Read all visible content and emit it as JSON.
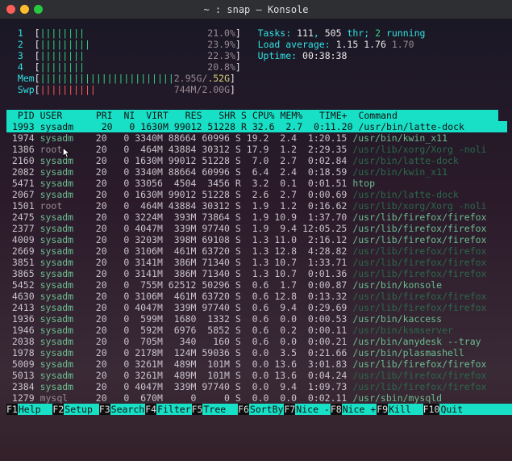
{
  "titlebar": {
    "title": "~ : snap — Konsole"
  },
  "cpu_meters": [
    {
      "id": "1",
      "pct": "21.0%"
    },
    {
      "id": "2",
      "pct": "23.9%"
    },
    {
      "id": "3",
      "pct": "22.3%"
    },
    {
      "id": "4",
      "pct": "20.8%"
    }
  ],
  "mem": {
    "label": "Mem",
    "used": "2.95G",
    "slab": ".52G",
    "pct": ""
  },
  "swp": {
    "label": "Swp",
    "used": "744M",
    "total": "2.00G"
  },
  "summary": {
    "tasks_label": "Tasks:",
    "tasks": "111",
    "thr": "505",
    "thr_label": "thr;",
    "running": "2",
    "running_label": "running",
    "la_label": "Load average:",
    "la1": "1.15",
    "la2": "1.76",
    "la3": "1.70",
    "up_label": "Uptime:",
    "uptime": "00:38:38"
  },
  "columns": {
    "pid": "PID",
    "user": "USER",
    "pri": "PRI",
    "ni": "NI",
    "virt": "VIRT",
    "res": "RES",
    "shr": "SHR",
    "s": "S",
    "cpu": "CPU%",
    "mem": "MEM%",
    "time": "TIME+",
    "cmd": "Command"
  },
  "selected": {
    "pid": "1993",
    "user": "sysadm",
    "pri": "20",
    "ni": "0",
    "virt": "1630M",
    "res": "99012",
    "shr": "51228",
    "s": "R",
    "cpu": "32.6",
    "mem": "2.7",
    "time": "0:11.20",
    "cmd": "/usr/bin/latte-dock"
  },
  "procs": [
    {
      "pid": "1974",
      "user": "sysadm",
      "pri": "20",
      "ni": "0",
      "virt": "3340M",
      "res": "88664",
      "shr": "60996",
      "s": "S",
      "cpu": "19.2",
      "mem": "2.4",
      "time": "1:20.15",
      "cmd": "/usr/bin/kwin_x11",
      "dim": false
    },
    {
      "pid": "1386",
      "user": "root",
      "pri": "20",
      "ni": "0",
      "virt": "464M",
      "res": "43884",
      "shr": "30312",
      "s": "S",
      "cpu": "17.9",
      "mem": "1.2",
      "time": "2:29.35",
      "cmd": "/usr/lib/xorg/Xorg -noli",
      "dim": true
    },
    {
      "pid": "2160",
      "user": "sysadm",
      "pri": "20",
      "ni": "0",
      "virt": "1630M",
      "res": "99012",
      "shr": "51228",
      "s": "S",
      "cpu": "7.0",
      "mem": "2.7",
      "time": "0:02.84",
      "cmd": "/usr/bin/latte-dock",
      "dim": true
    },
    {
      "pid": "2082",
      "user": "sysadm",
      "pri": "20",
      "ni": "0",
      "virt": "3340M",
      "res": "88664",
      "shr": "60996",
      "s": "S",
      "cpu": "6.4",
      "mem": "2.4",
      "time": "0:18.59",
      "cmd": "/usr/bin/kwin_x11",
      "dim": true
    },
    {
      "pid": "5471",
      "user": "sysadm",
      "pri": "20",
      "ni": "0",
      "virt": "33056",
      "res": "4504",
      "shr": "3456",
      "s": "R",
      "cpu": "3.2",
      "mem": "0.1",
      "time": "0:01.51",
      "cmd": "htop",
      "dim": false
    },
    {
      "pid": "2067",
      "user": "sysadm",
      "pri": "20",
      "ni": "0",
      "virt": "1630M",
      "res": "99012",
      "shr": "51228",
      "s": "S",
      "cpu": "2.6",
      "mem": "2.7",
      "time": "0:00.69",
      "cmd": "/usr/bin/latte-dock",
      "dim": true
    },
    {
      "pid": "1501",
      "user": "root",
      "pri": "20",
      "ni": "0",
      "virt": "464M",
      "res": "43884",
      "shr": "30312",
      "s": "S",
      "cpu": "1.9",
      "mem": "1.2",
      "time": "0:16.62",
      "cmd": "/usr/lib/xorg/Xorg -noli",
      "dim": true
    },
    {
      "pid": "2475",
      "user": "sysadm",
      "pri": "20",
      "ni": "0",
      "virt": "3224M",
      "res": "393M",
      "shr": "73864",
      "s": "S",
      "cpu": "1.9",
      "mem": "10.9",
      "time": "1:37.70",
      "cmd": "/usr/lib/firefox/firefox",
      "dim": false
    },
    {
      "pid": "2377",
      "user": "sysadm",
      "pri": "20",
      "ni": "0",
      "virt": "4047M",
      "res": "339M",
      "shr": "97740",
      "s": "S",
      "cpu": "1.9",
      "mem": "9.4",
      "time": "12:05.25",
      "cmd": "/usr/lib/firefox/firefox",
      "dim": false
    },
    {
      "pid": "4009",
      "user": "sysadm",
      "pri": "20",
      "ni": "0",
      "virt": "3203M",
      "res": "398M",
      "shr": "69108",
      "s": "S",
      "cpu": "1.3",
      "mem": "11.0",
      "time": "2:16.12",
      "cmd": "/usr/lib/firefox/firefox",
      "dim": false
    },
    {
      "pid": "2669",
      "user": "sysadm",
      "pri": "20",
      "ni": "0",
      "virt": "3106M",
      "res": "461M",
      "shr": "63720",
      "s": "S",
      "cpu": "1.3",
      "mem": "12.8",
      "time": "4:28.82",
      "cmd": "/usr/lib/firefox/firefox",
      "dim": true
    },
    {
      "pid": "3851",
      "user": "sysadm",
      "pri": "20",
      "ni": "0",
      "virt": "3141M",
      "res": "386M",
      "shr": "71340",
      "s": "S",
      "cpu": "1.3",
      "mem": "10.7",
      "time": "1:33.71",
      "cmd": "/usr/lib/firefox/firefox",
      "dim": true
    },
    {
      "pid": "3865",
      "user": "sysadm",
      "pri": "20",
      "ni": "0",
      "virt": "3141M",
      "res": "386M",
      "shr": "71340",
      "s": "S",
      "cpu": "1.3",
      "mem": "10.7",
      "time": "0:01.36",
      "cmd": "/usr/lib/firefox/firefox",
      "dim": true
    },
    {
      "pid": "5452",
      "user": "sysadm",
      "pri": "20",
      "ni": "0",
      "virt": "755M",
      "res": "62512",
      "shr": "50296",
      "s": "S",
      "cpu": "0.6",
      "mem": "1.7",
      "time": "0:00.87",
      "cmd": "/usr/bin/konsole",
      "dim": false
    },
    {
      "pid": "4630",
      "user": "sysadm",
      "pri": "20",
      "ni": "0",
      "virt": "3106M",
      "res": "461M",
      "shr": "63720",
      "s": "S",
      "cpu": "0.6",
      "mem": "12.8",
      "time": "0:13.32",
      "cmd": "/usr/lib/firefox/firefox",
      "dim": true
    },
    {
      "pid": "2413",
      "user": "sysadm",
      "pri": "20",
      "ni": "0",
      "virt": "4047M",
      "res": "339M",
      "shr": "97740",
      "s": "S",
      "cpu": "0.6",
      "mem": "9.4",
      "time": "0:29.69",
      "cmd": "/usr/lib/firefox/firefox",
      "dim": true
    },
    {
      "pid": "1936",
      "user": "sysadm",
      "pri": "20",
      "ni": "0",
      "virt": "599M",
      "res": "1680",
      "shr": "1332",
      "s": "S",
      "cpu": "0.6",
      "mem": "0.0",
      "time": "0:00.53",
      "cmd": "/usr/bin/kaccess",
      "dim": false
    },
    {
      "pid": "1946",
      "user": "sysadm",
      "pri": "20",
      "ni": "0",
      "virt": "592M",
      "res": "6976",
      "shr": "5852",
      "s": "S",
      "cpu": "0.6",
      "mem": "0.2",
      "time": "0:00.11",
      "cmd": "/usr/bin/ksmserver",
      "dim": true
    },
    {
      "pid": "2038",
      "user": "sysadm",
      "pri": "20",
      "ni": "0",
      "virt": "705M",
      "res": "340",
      "shr": "160",
      "s": "S",
      "cpu": "0.6",
      "mem": "0.0",
      "time": "0:00.21",
      "cmd": "/usr/bin/anydesk --tray",
      "dim": false
    },
    {
      "pid": "1978",
      "user": "sysadm",
      "pri": "20",
      "ni": "0",
      "virt": "2178M",
      "res": "124M",
      "shr": "59036",
      "s": "S",
      "cpu": "0.0",
      "mem": "3.5",
      "time": "0:21.66",
      "cmd": "/usr/bin/plasmashell",
      "dim": false
    },
    {
      "pid": "5009",
      "user": "sysadm",
      "pri": "20",
      "ni": "0",
      "virt": "3261M",
      "res": "489M",
      "shr": "101M",
      "s": "S",
      "cpu": "0.0",
      "mem": "13.6",
      "time": "3:01.83",
      "cmd": "/usr/lib/firefox/firefox",
      "dim": false
    },
    {
      "pid": "5013",
      "user": "sysadm",
      "pri": "20",
      "ni": "0",
      "virt": "3261M",
      "res": "489M",
      "shr": "101M",
      "s": "S",
      "cpu": "0.0",
      "mem": "13.6",
      "time": "0:04.24",
      "cmd": "/usr/lib/firefox/firefox",
      "dim": true
    },
    {
      "pid": "2384",
      "user": "sysadm",
      "pri": "20",
      "ni": "0",
      "virt": "4047M",
      "res": "339M",
      "shr": "97740",
      "s": "S",
      "cpu": "0.0",
      "mem": "9.4",
      "time": "1:09.73",
      "cmd": "/usr/lib/firefox/firefox",
      "dim": true
    },
    {
      "pid": "1279",
      "user": "mysql",
      "pri": "20",
      "ni": "0",
      "virt": "670M",
      "res": "0",
      "shr": "0",
      "s": "S",
      "cpu": "0.0",
      "mem": "0.0",
      "time": "0:02.11",
      "cmd": "/usr/sbin/mysqld",
      "dim": false
    }
  ],
  "footer": [
    {
      "k": "F1",
      "l": "Help"
    },
    {
      "k": "F2",
      "l": "Setup"
    },
    {
      "k": "F3",
      "l": "Search"
    },
    {
      "k": "F4",
      "l": "Filter"
    },
    {
      "k": "F5",
      "l": "Tree"
    },
    {
      "k": "F6",
      "l": "SortBy"
    },
    {
      "k": "F7",
      "l": "Nice -"
    },
    {
      "k": "F8",
      "l": "Nice +"
    },
    {
      "k": "F9",
      "l": "Kill"
    },
    {
      "k": "F10",
      "l": "Quit"
    }
  ]
}
